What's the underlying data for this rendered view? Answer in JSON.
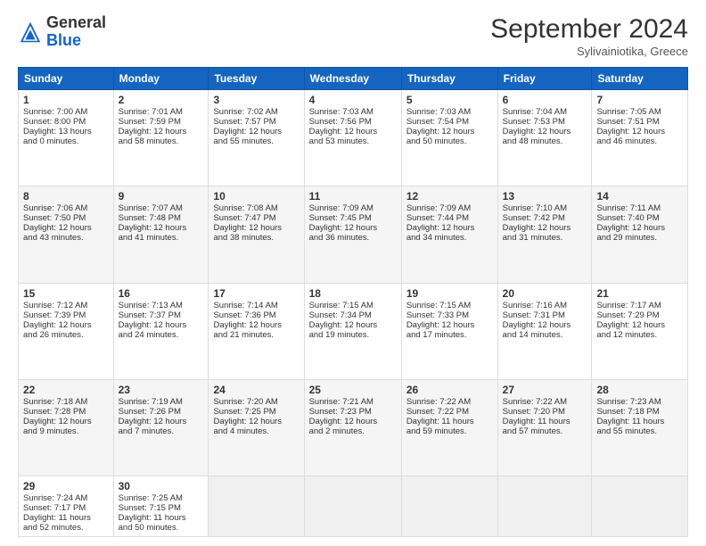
{
  "header": {
    "logo_general": "General",
    "logo_blue": "Blue",
    "month": "September 2024",
    "location": "Sylivainiotika, Greece"
  },
  "days_of_week": [
    "Sunday",
    "Monday",
    "Tuesday",
    "Wednesday",
    "Thursday",
    "Friday",
    "Saturday"
  ],
  "weeks": [
    [
      {
        "day": "1",
        "lines": [
          "Sunrise: 7:00 AM",
          "Sunset: 8:00 PM",
          "Daylight: 13 hours",
          "and 0 minutes."
        ]
      },
      {
        "day": "2",
        "lines": [
          "Sunrise: 7:01 AM",
          "Sunset: 7:59 PM",
          "Daylight: 12 hours",
          "and 58 minutes."
        ]
      },
      {
        "day": "3",
        "lines": [
          "Sunrise: 7:02 AM",
          "Sunset: 7:57 PM",
          "Daylight: 12 hours",
          "and 55 minutes."
        ]
      },
      {
        "day": "4",
        "lines": [
          "Sunrise: 7:03 AM",
          "Sunset: 7:56 PM",
          "Daylight: 12 hours",
          "and 53 minutes."
        ]
      },
      {
        "day": "5",
        "lines": [
          "Sunrise: 7:03 AM",
          "Sunset: 7:54 PM",
          "Daylight: 12 hours",
          "and 50 minutes."
        ]
      },
      {
        "day": "6",
        "lines": [
          "Sunrise: 7:04 AM",
          "Sunset: 7:53 PM",
          "Daylight: 12 hours",
          "and 48 minutes."
        ]
      },
      {
        "day": "7",
        "lines": [
          "Sunrise: 7:05 AM",
          "Sunset: 7:51 PM",
          "Daylight: 12 hours",
          "and 46 minutes."
        ]
      }
    ],
    [
      {
        "day": "8",
        "lines": [
          "Sunrise: 7:06 AM",
          "Sunset: 7:50 PM",
          "Daylight: 12 hours",
          "and 43 minutes."
        ]
      },
      {
        "day": "9",
        "lines": [
          "Sunrise: 7:07 AM",
          "Sunset: 7:48 PM",
          "Daylight: 12 hours",
          "and 41 minutes."
        ]
      },
      {
        "day": "10",
        "lines": [
          "Sunrise: 7:08 AM",
          "Sunset: 7:47 PM",
          "Daylight: 12 hours",
          "and 38 minutes."
        ]
      },
      {
        "day": "11",
        "lines": [
          "Sunrise: 7:09 AM",
          "Sunset: 7:45 PM",
          "Daylight: 12 hours",
          "and 36 minutes."
        ]
      },
      {
        "day": "12",
        "lines": [
          "Sunrise: 7:09 AM",
          "Sunset: 7:44 PM",
          "Daylight: 12 hours",
          "and 34 minutes."
        ]
      },
      {
        "day": "13",
        "lines": [
          "Sunrise: 7:10 AM",
          "Sunset: 7:42 PM",
          "Daylight: 12 hours",
          "and 31 minutes."
        ]
      },
      {
        "day": "14",
        "lines": [
          "Sunrise: 7:11 AM",
          "Sunset: 7:40 PM",
          "Daylight: 12 hours",
          "and 29 minutes."
        ]
      }
    ],
    [
      {
        "day": "15",
        "lines": [
          "Sunrise: 7:12 AM",
          "Sunset: 7:39 PM",
          "Daylight: 12 hours",
          "and 26 minutes."
        ]
      },
      {
        "day": "16",
        "lines": [
          "Sunrise: 7:13 AM",
          "Sunset: 7:37 PM",
          "Daylight: 12 hours",
          "and 24 minutes."
        ]
      },
      {
        "day": "17",
        "lines": [
          "Sunrise: 7:14 AM",
          "Sunset: 7:36 PM",
          "Daylight: 12 hours",
          "and 21 minutes."
        ]
      },
      {
        "day": "18",
        "lines": [
          "Sunrise: 7:15 AM",
          "Sunset: 7:34 PM",
          "Daylight: 12 hours",
          "and 19 minutes."
        ]
      },
      {
        "day": "19",
        "lines": [
          "Sunrise: 7:15 AM",
          "Sunset: 7:33 PM",
          "Daylight: 12 hours",
          "and 17 minutes."
        ]
      },
      {
        "day": "20",
        "lines": [
          "Sunrise: 7:16 AM",
          "Sunset: 7:31 PM",
          "Daylight: 12 hours",
          "and 14 minutes."
        ]
      },
      {
        "day": "21",
        "lines": [
          "Sunrise: 7:17 AM",
          "Sunset: 7:29 PM",
          "Daylight: 12 hours",
          "and 12 minutes."
        ]
      }
    ],
    [
      {
        "day": "22",
        "lines": [
          "Sunrise: 7:18 AM",
          "Sunset: 7:28 PM",
          "Daylight: 12 hours",
          "and 9 minutes."
        ]
      },
      {
        "day": "23",
        "lines": [
          "Sunrise: 7:19 AM",
          "Sunset: 7:26 PM",
          "Daylight: 12 hours",
          "and 7 minutes."
        ]
      },
      {
        "day": "24",
        "lines": [
          "Sunrise: 7:20 AM",
          "Sunset: 7:25 PM",
          "Daylight: 12 hours",
          "and 4 minutes."
        ]
      },
      {
        "day": "25",
        "lines": [
          "Sunrise: 7:21 AM",
          "Sunset: 7:23 PM",
          "Daylight: 12 hours",
          "and 2 minutes."
        ]
      },
      {
        "day": "26",
        "lines": [
          "Sunrise: 7:22 AM",
          "Sunset: 7:22 PM",
          "Daylight: 11 hours",
          "and 59 minutes."
        ]
      },
      {
        "day": "27",
        "lines": [
          "Sunrise: 7:22 AM",
          "Sunset: 7:20 PM",
          "Daylight: 11 hours",
          "and 57 minutes."
        ]
      },
      {
        "day": "28",
        "lines": [
          "Sunrise: 7:23 AM",
          "Sunset: 7:18 PM",
          "Daylight: 11 hours",
          "and 55 minutes."
        ]
      }
    ],
    [
      {
        "day": "29",
        "lines": [
          "Sunrise: 7:24 AM",
          "Sunset: 7:17 PM",
          "Daylight: 11 hours",
          "and 52 minutes."
        ]
      },
      {
        "day": "30",
        "lines": [
          "Sunrise: 7:25 AM",
          "Sunset: 7:15 PM",
          "Daylight: 11 hours",
          "and 50 minutes."
        ]
      },
      null,
      null,
      null,
      null,
      null
    ]
  ]
}
